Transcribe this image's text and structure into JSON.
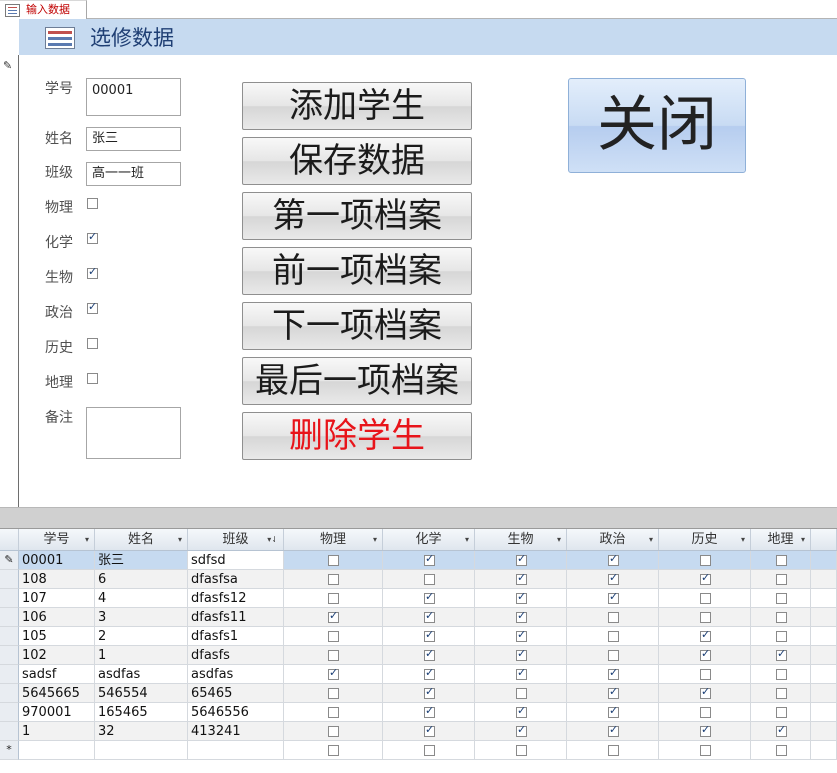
{
  "tab": {
    "label": "输入数据"
  },
  "header": {
    "title": "选修数据"
  },
  "form": {
    "labels": {
      "id": "学号",
      "name": "姓名",
      "class": "班级",
      "physics": "物理",
      "chemistry": "化学",
      "biology": "生物",
      "politics": "政治",
      "history": "历史",
      "geography": "地理",
      "notes": "备注"
    },
    "values": {
      "id": "00001",
      "name": "张三",
      "class": "高一一班",
      "notes": ""
    },
    "checks": {
      "physics": false,
      "chemistry": true,
      "biology": true,
      "politics": true,
      "history": false,
      "geography": false
    }
  },
  "buttons": {
    "add_student": "添加学生",
    "save_data": "保存数据",
    "first_record": "第一项档案",
    "prev_record": "前一项档案",
    "next_record": "下一项档案",
    "last_record": "最后一项档案",
    "delete_student": "删除学生",
    "close": "关闭"
  },
  "colors": {
    "delete_text": "#e8141a",
    "header_band": "#c6daf0",
    "title_text": "#1f3f74"
  },
  "datasheet": {
    "columns": [
      "学号",
      "姓名",
      "班级",
      "物理",
      "化学",
      "生物",
      "政治",
      "历史",
      "地理"
    ],
    "rows": [
      {
        "id": "00001",
        "name": "张三",
        "class": "sdfsd",
        "checks": [
          false,
          true,
          true,
          true,
          false,
          false
        ]
      },
      {
        "id": "108",
        "name": "6",
        "class": "dfasfsa",
        "checks": [
          false,
          false,
          true,
          true,
          true,
          false
        ]
      },
      {
        "id": "107",
        "name": "4",
        "class": "dfasfs12",
        "checks": [
          false,
          true,
          true,
          true,
          false,
          false
        ]
      },
      {
        "id": "106",
        "name": "3",
        "class": "dfasfs11",
        "checks": [
          true,
          true,
          true,
          false,
          false,
          false
        ]
      },
      {
        "id": "105",
        "name": "2",
        "class": "dfasfs1",
        "checks": [
          false,
          true,
          true,
          false,
          true,
          false
        ]
      },
      {
        "id": "102",
        "name": "1",
        "class": "dfasfs",
        "checks": [
          false,
          true,
          true,
          false,
          true,
          true
        ]
      },
      {
        "id": "sadsf",
        "name": "asdfas",
        "class": "asdfas",
        "checks": [
          true,
          true,
          true,
          true,
          false,
          false
        ]
      },
      {
        "id": "5645665",
        "name": "546554",
        "class": "65465",
        "checks": [
          false,
          true,
          false,
          true,
          true,
          false
        ]
      },
      {
        "id": "970001",
        "name": "165465",
        "class": "5646556",
        "checks": [
          false,
          true,
          true,
          true,
          false,
          false
        ]
      },
      {
        "id": "1",
        "name": "32",
        "class": "413241",
        "checks": [
          false,
          true,
          true,
          true,
          true,
          true
        ]
      }
    ],
    "new_row_marker": "*",
    "current_row_marker": "✎"
  }
}
